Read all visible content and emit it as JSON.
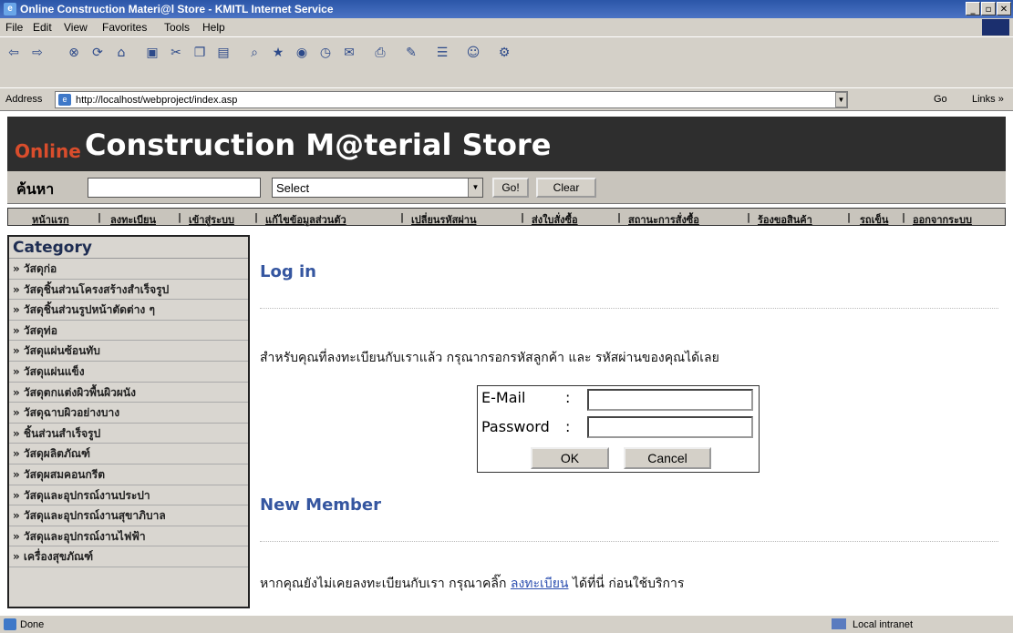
{
  "window": {
    "title": "Online Construction Materi@l Store - KMITL Internet Service",
    "buttons": [
      "_",
      "▫",
      "✕"
    ]
  },
  "menu": [
    "File",
    "Edit",
    "View",
    "Favorites",
    "Tools",
    "Help"
  ],
  "address": {
    "label": "Address",
    "url": "http://localhost/webproject/index.asp",
    "go": "Go",
    "links": "Links »"
  },
  "site": {
    "online": "Online",
    "store": "Construction M@terial Store"
  },
  "search": {
    "label": "ค้นหา",
    "select_value": "Select",
    "go_label": "Go!",
    "clear_label": "Clear"
  },
  "nav": [
    "หน้าแรก",
    "ลงทะเบียน",
    "เข้าสู่ระบบ",
    "แก้ไขข้อมูลส่วนตัว",
    "เปลี่ยนรหัสผ่าน",
    "ส่งใบสั่งซื้อ",
    "สถานะการสั่งซื้อ",
    "ร้องขอสินค้า",
    "รถเข็น",
    "ออกจากระบบ"
  ],
  "sidebar": {
    "heading": "Category",
    "items": [
      "» วัสดุก่อ",
      "» วัสดุชิ้นส่วนโครงสร้างสำเร็จรูป",
      "» วัสดุชิ้นส่วนรูปหน้าตัดต่าง ๆ",
      "» วัสดุท่อ",
      "» วัสดุแผ่นซ้อนทับ",
      "» วัสดุแผ่นแข็ง",
      "» วัสดุตกแต่งผิวพื้นผิวผนัง",
      "» วัสดุฉาบผิวอย่างบาง",
      "» ชิ้นส่วนสำเร็จรูป",
      "» วัสดุผลิตภัณฑ์",
      "» วัสดุผสมคอนกรีต",
      "» วัสดุและอุปกรณ์งานประปา",
      "» วัสดุและอุปกรณ์งานสุขาภิบาล",
      "» วัสดุและอุปกรณ์งานไฟฟ้า",
      "» เครื่องสุขภัณฑ์"
    ]
  },
  "login": {
    "title": "Log in",
    "instruction": "สำหรับคุณที่ลงทะเบียนกับเราแล้ว กรุณากรอกรหัสลูกค้า และ รหัสผ่านของคุณได้เลย",
    "email_label": "E-Mail",
    "password_label": "Password",
    "colon": ":",
    "ok_label": "OK",
    "cancel_label": "Cancel"
  },
  "new_member": {
    "title": "New Member",
    "text_before": "หากคุณยังไม่เคยลงทะเบียนกับเรา กรุณาคลิ๊ก ",
    "link": "ลงทะเบียน",
    "text_after": " ได้ที่นี่ ก่อนใช้บริการ"
  },
  "status": {
    "left": "Done",
    "zone": "Local intranet"
  }
}
